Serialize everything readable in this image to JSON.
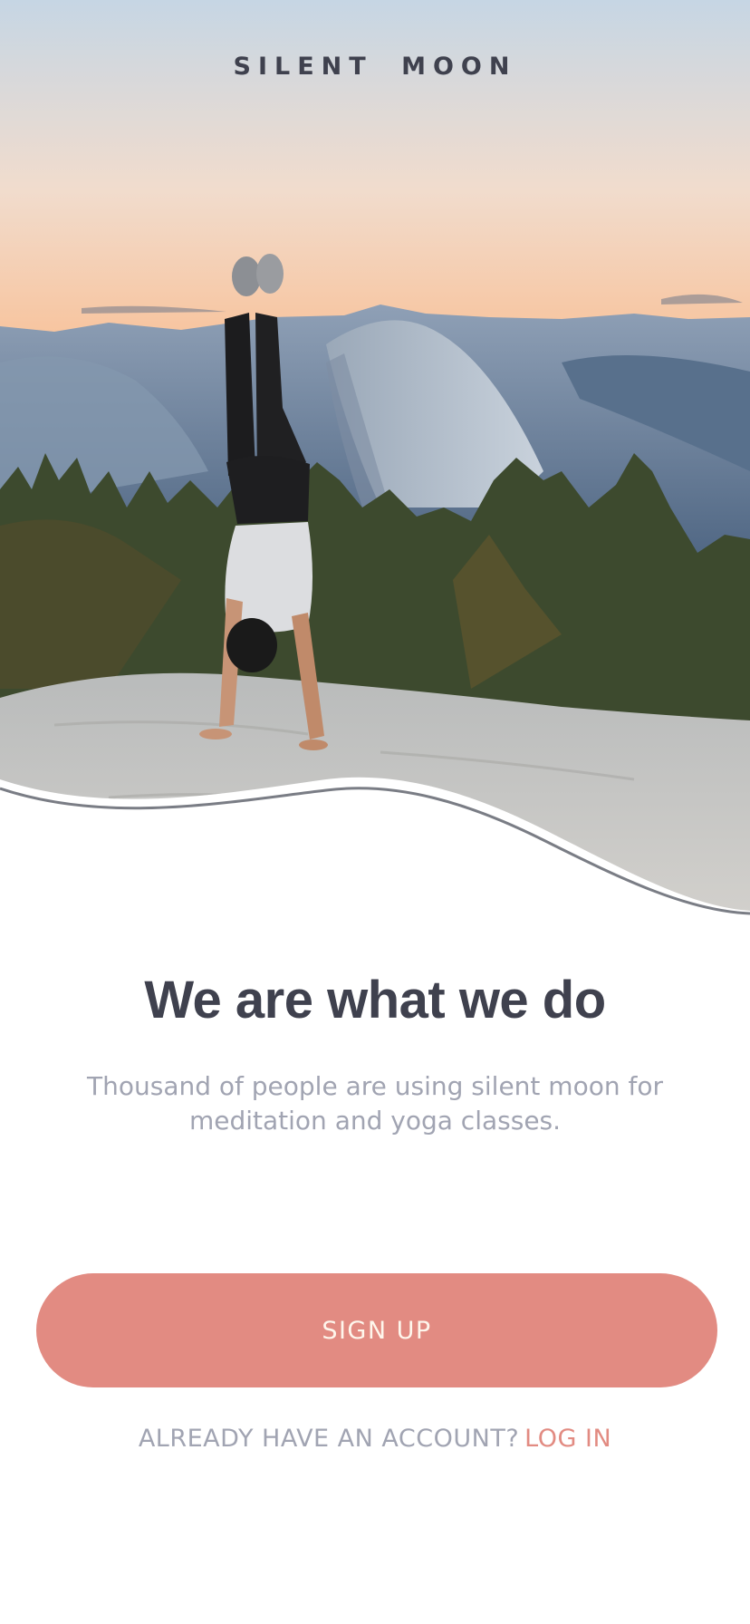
{
  "app": {
    "brand_name": "SILENT  MOON"
  },
  "hero": {
    "image_description_icon": "yoga-handstand-photo",
    "colors": {
      "sky_top": "#c9d8e6",
      "sky_horizon": "#f6c8a6",
      "mountain": "#6f86a3",
      "trees": "#3e4a2c",
      "rock": "#c7c6c2"
    }
  },
  "main": {
    "headline": "We are what we do",
    "subtext": "Thousand of people are using silent moon for meditation and yoga classes."
  },
  "actions": {
    "signup_label": "SIGN UP",
    "already_account_text": "ALREADY HAVE AN ACCOUNT?",
    "login_label": "LOG IN"
  },
  "theme": {
    "accent": "#e28b82",
    "text_dark": "#3f414e",
    "text_muted": "#a1a4b2",
    "button_text": "#fef6ec"
  }
}
